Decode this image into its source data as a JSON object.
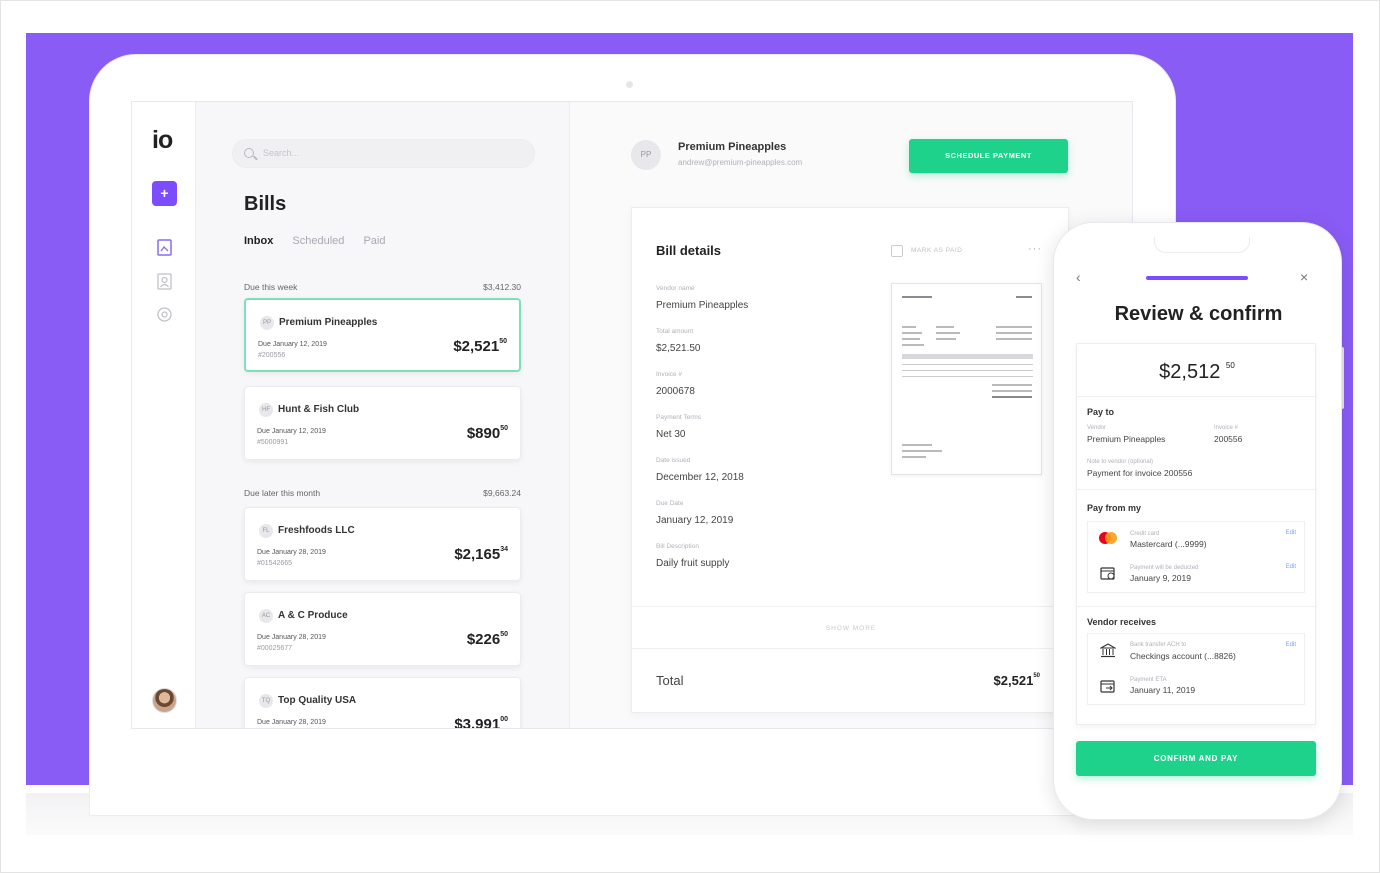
{
  "colors": {
    "purple": "#8a5cf6",
    "accent": "#7c4dff",
    "green": "#1ed28c"
  },
  "rail": {
    "logo": "io",
    "new_icon": "+"
  },
  "bills": {
    "search_placeholder": "Search...",
    "title": "Bills",
    "tabs": [
      "Inbox",
      "Scheduled",
      "Paid"
    ],
    "groups": [
      {
        "label": "Due this week",
        "amount": "$3,412.30"
      },
      {
        "label": "Due later this month",
        "amount": "$9,663.24"
      }
    ],
    "cards": [
      {
        "initials": "PP",
        "vendor": "Premium Pineapples",
        "due": "Due January 12, 2019",
        "number": "#200556",
        "price": "$2,521",
        "cents": "50"
      },
      {
        "initials": "HF",
        "vendor": "Hunt & Fish Club",
        "due": "Due January 12, 2019",
        "number": "#5000991",
        "price": "$890",
        "cents": "50"
      },
      {
        "initials": "FL",
        "vendor": "Freshfoods LLC",
        "due": "Due January 28, 2019",
        "number": "#01542665",
        "price": "$2,165",
        "cents": "34"
      },
      {
        "initials": "AC",
        "vendor": "A & C Produce",
        "due": "Due January 28, 2019",
        "number": "#00025677",
        "price": "$226",
        "cents": "50"
      },
      {
        "initials": "TQ",
        "vendor": "Top Quality USA",
        "due": "Due January 28, 2019",
        "number": "",
        "price": "$3,991",
        "cents": "00"
      }
    ]
  },
  "detail": {
    "vendor_initials": "PP",
    "vendor_name": "Premium Pineapples",
    "vendor_email": "andrew@premium-pineapples.com",
    "schedule_button": "SCHEDULE PAYMENT",
    "card_title": "Bill details",
    "mark_as_paid": "MARK AS PAID",
    "more": "···",
    "fields": [
      {
        "label": "Vendor name",
        "value": "Premium Pineapples"
      },
      {
        "label": "Total amount",
        "value": "$2,521.50"
      },
      {
        "label": "Invoice #",
        "value": "2000678"
      },
      {
        "label": "Payment Terms",
        "value": "Net 30"
      },
      {
        "label": "Date issued",
        "value": "December 12, 2018"
      },
      {
        "label": "Due Date",
        "value": "January 12, 2019"
      },
      {
        "label": "Bill Description",
        "value": "Daily fruit supply"
      }
    ],
    "show_more": "SHOW MORE",
    "total_label": "Total",
    "total_value": "$2,521",
    "total_cents": "50"
  },
  "phone": {
    "title": "Review & confirm",
    "amount": "$2,512",
    "amount_cents": "50",
    "pay_to": "Pay to",
    "vendor_label": "Vendor",
    "vendor_value": "Premium Pineapples",
    "invoice_label": "Invoice #",
    "invoice_value": "200556",
    "note_label": "Note to vendor (optional)",
    "note_value": "Payment for invoice 200556",
    "pay_from": "Pay from my",
    "card_label": "Credit card",
    "card_value": "Mastercard (...9999)",
    "deduct_label": "Payment will be deducted",
    "deduct_value": "January 9, 2019",
    "vendor_receives": "Vendor receives",
    "bank_label": "Bank transfer ACH to",
    "bank_value": "Checkings account (...8826)",
    "eta_label": "Payment ETA",
    "eta_value": "January 11, 2019",
    "edit": "Edit",
    "confirm_button": "CONFIRM AND PAY"
  }
}
